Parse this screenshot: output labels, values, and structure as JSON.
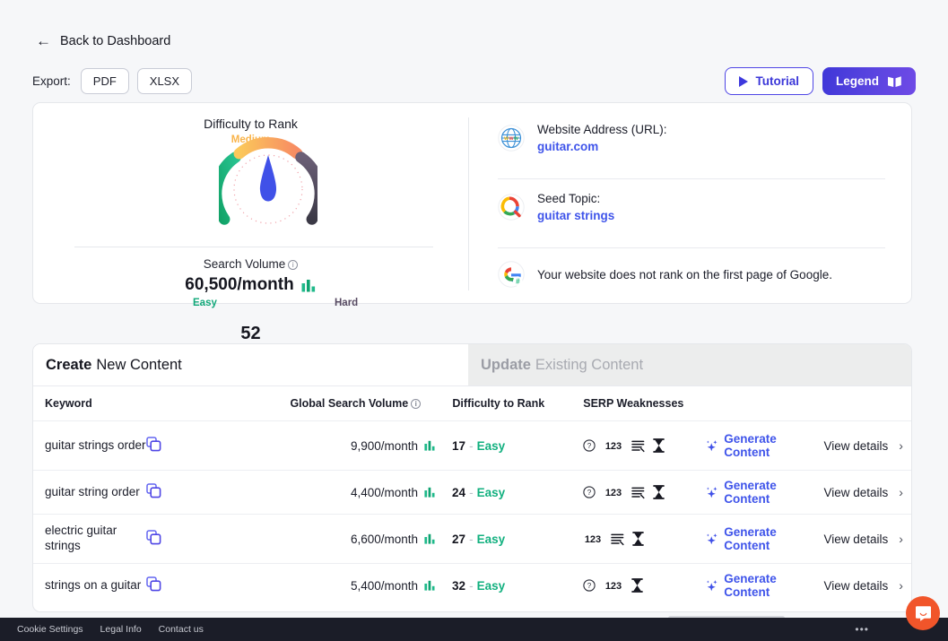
{
  "nav": {
    "back_label": "Back to Dashboard",
    "back_icon": "arrow-left-icon"
  },
  "export": {
    "label": "Export:",
    "buttons": [
      "PDF",
      "XLSX"
    ]
  },
  "actions": {
    "tutorial_label": "Tutorial",
    "tutorial_icon": "play-icon",
    "legend_label": "Legend",
    "legend_icon": "book-icon"
  },
  "summary": {
    "gauge": {
      "title": "Difficulty to Rank",
      "score": "52",
      "easy_label": "Easy",
      "medium_label": "Medium",
      "hard_label": "Hard",
      "easy_color": "#12a87a",
      "medium_color": "#f9b44a",
      "hard_color": "#564a62",
      "needle_color": "#4051e8"
    },
    "search_volume": {
      "label": "Search Volume",
      "info_icon": "info-icon",
      "value": "60,500/month",
      "chart_icon": "bar-chart-icon"
    },
    "info_rows": [
      {
        "icon": "www-globe-icon",
        "title": "Website Address (URL):",
        "value": "guitar.com"
      },
      {
        "icon": "google-search-icon",
        "title": "Seed Topic:",
        "value": "guitar strings"
      },
      {
        "icon": "google-rank-icon",
        "text": "Your website does not rank on the first page of Google."
      }
    ]
  },
  "tabs": [
    {
      "bold": "Create",
      "rest": "New Content",
      "active": true
    },
    {
      "bold": "Update",
      "rest": "Existing Content",
      "active": false
    }
  ],
  "table": {
    "headers": {
      "keyword": "Keyword",
      "volume": "Global Search Volume",
      "volume_info_icon": "info-icon",
      "difficulty": "Difficulty to Rank",
      "serp": "SERP Weaknesses"
    },
    "generate_label": "Generate Content",
    "generate_icon": "sparkles-icon",
    "view_label": "View details",
    "view_icon": "chevron-right-icon",
    "copy_icon": "copy-icon",
    "rows": [
      {
        "keyword": "guitar strings order",
        "volume": "9,900/month",
        "difficulty_score": "17",
        "difficulty_label": "Easy",
        "serp_icons": [
          "question-circle-icon",
          "numbers-123-icon",
          "list-lines-icon",
          "hourglass-icon"
        ]
      },
      {
        "keyword": "guitar string order",
        "volume": "4,400/month",
        "difficulty_score": "24",
        "difficulty_label": "Easy",
        "serp_icons": [
          "question-circle-icon",
          "numbers-123-icon",
          "list-lines-icon",
          "hourglass-icon"
        ]
      },
      {
        "keyword": "electric guitar strings",
        "volume": "6,600/month",
        "difficulty_score": "27",
        "difficulty_label": "Easy",
        "serp_icons": [
          "numbers-123-icon",
          "list-lines-icon",
          "hourglass-icon"
        ]
      },
      {
        "keyword": "strings on a guitar",
        "volume": "5,400/month",
        "difficulty_score": "32",
        "difficulty_label": "Easy",
        "serp_icons": [
          "question-circle-icon",
          "numbers-123-icon",
          "hourglass-icon"
        ]
      }
    ]
  },
  "footer": {
    "links": [
      "Cookie Settings",
      "Legal Info",
      "Contact us"
    ],
    "more_icon": "ellipsis-icon"
  },
  "chat": {
    "icon": "chat-bubble-icon",
    "color": "#f1552a"
  }
}
